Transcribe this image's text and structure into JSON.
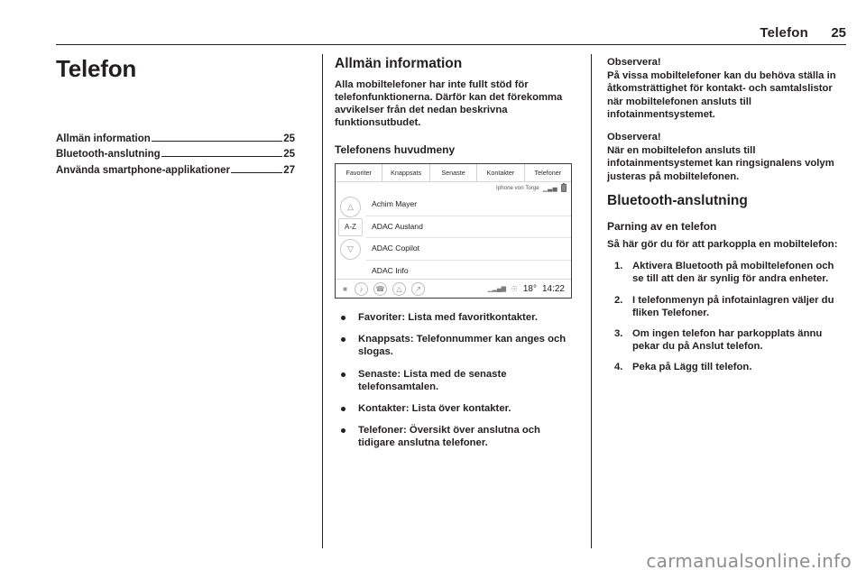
{
  "header": {
    "title": "Telefon",
    "page_number": "25"
  },
  "column_left": {
    "chapter_title": "Telefon",
    "toc": [
      {
        "label": "Allmän information",
        "page": "25"
      },
      {
        "label": "Bluetooth-anslutning",
        "page": "25"
      },
      {
        "label": "Använda smartphone-applikationer",
        "page": "27"
      }
    ]
  },
  "column_middle": {
    "section_title": "Allmän information",
    "intro": "Alla mobiltelefoner har inte fullt stöd för telefonfunktionerna. Därför kan det förekomma avvikelser från det nedan beskrivna funktionsutbudet.",
    "subsection_title": "Telefonens huvudmeny",
    "screen": {
      "tabs": [
        "Favoriter",
        "Knappsats",
        "Senaste",
        "Kontakter",
        "Telefoner"
      ],
      "device_name": "Iphone von Torge",
      "signal_icon": "signal-bars-icon",
      "battery_icon": "battery-icon",
      "scroll_up_icon": "chevron-up-icon",
      "scroll_down_icon": "chevron-down-icon",
      "az_label": "A-Z",
      "contacts": [
        "Achim Mayer",
        "ADAC Ausland",
        "ADAC Copilot",
        "ADAC Info"
      ],
      "bottom_bar": {
        "home_icon": "home-icon",
        "media_icon": "music-note-icon",
        "phone_icon": "phone-icon",
        "nav_icon": "navigation-arrow-icon",
        "settings_icon": "tools-icon",
        "reception_icon": "reception-bars-icon",
        "location_icon": "location-pin-icon",
        "temperature": "18°",
        "clock": "14:22"
      }
    },
    "bullets": [
      {
        "term": "Favoriter",
        "text": ": Lista med favoritkontakter."
      },
      {
        "term": "Knappsats",
        "text": ": Telefonnummer kan anges och slogas."
      },
      {
        "term": "Senaste",
        "text": ": Lista med de senaste telefonsamtalen."
      },
      {
        "term": "Kontakter",
        "text": ": Lista över kontakter."
      },
      {
        "term": "Telefoner",
        "text": ": Översikt över anslutna och tidigare anslutna telefoner."
      }
    ]
  },
  "column_right": {
    "note_1": {
      "title": "Observera!",
      "body": "På vissa mobiltelefoner kan du behöva ställa in åtkomsträttighet för kontakt- och samtalslistor när mobiltelefonen ansluts till infotainmentsystemet."
    },
    "note_2": {
      "title": "Observera!",
      "body": "När en mobiltelefon ansluts till infotainmentsystemet kan ringsignalens volym justeras på mobiltelefonen."
    },
    "section_title": "Bluetooth-anslutning",
    "subsection_title": "Parning av en telefon",
    "intro": "Så här gör du för att parkoppla en mobiltelefon:",
    "steps": [
      "Aktivera Bluetooth på mobiltelefonen och se till att den är synlig för andra enheter.",
      "I telefonmenyn på infotainlagren väljer du fliken Telefoner.",
      "Om ingen telefon har parkopplats ännu pekar du på Anslut telefon.",
      "Peka på Lägg till telefon."
    ]
  },
  "watermark": "carmanualsonline.info"
}
